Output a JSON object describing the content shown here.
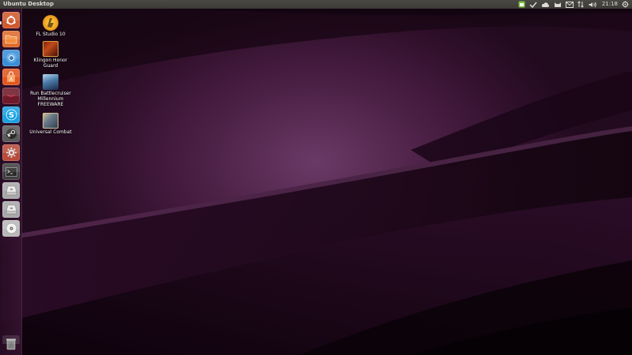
{
  "panel": {
    "title": "Ubuntu Desktop",
    "clock": "21:18",
    "indicators": [
      {
        "icon": "indicator-app-icon"
      },
      {
        "icon": "indicator-checkmark-icon"
      },
      {
        "icon": "indicator-cloud-icon"
      },
      {
        "icon": "indicator-cat-icon"
      },
      {
        "icon": "indicator-messages-icon"
      },
      {
        "icon": "indicator-network-icon"
      },
      {
        "icon": "indicator-volume-icon"
      },
      {
        "icon": "indicator-power-icon"
      }
    ]
  },
  "launcher": {
    "items": [
      {
        "name": "dash-home",
        "icon": "ubuntu-logo-icon",
        "color": "#d05a2e"
      },
      {
        "name": "files",
        "icon": "files-folder-icon",
        "color": "#e06a2a"
      },
      {
        "name": "chromium",
        "icon": "chromium-icon",
        "color": "#3a8fd6"
      },
      {
        "name": "software-center",
        "icon": "shopping-bag-icon",
        "color": "#e2571f"
      },
      {
        "name": "app-dark-red",
        "icon": "app-red-icon",
        "color": "#6e1a2a"
      },
      {
        "name": "skype",
        "icon": "skype-icon",
        "color": "#1aa0e0"
      },
      {
        "name": "steam",
        "icon": "steam-icon",
        "color": "#6a6a6a"
      },
      {
        "name": "system-settings",
        "icon": "gear-icon",
        "color": "#b84a3a"
      },
      {
        "name": "terminal",
        "icon": "terminal-icon",
        "color": "#4a4a4a"
      },
      {
        "name": "disk-1",
        "icon": "drive-icon",
        "color": "#9a9a9a"
      },
      {
        "name": "disk-2",
        "icon": "drive-icon",
        "color": "#9a9a9a"
      },
      {
        "name": "dvd",
        "icon": "dvd-icon",
        "color": "#b0b0b0"
      }
    ],
    "trash": {
      "icon": "trash-icon"
    }
  },
  "desktop": {
    "icons": [
      {
        "label": "FL Studio 10",
        "icon": "fl-studio-icon"
      },
      {
        "label": "Klingon Honor\nGuard",
        "icon": "klingon-honor-guard-icon"
      },
      {
        "label": "Run Battlecruiser\nMillennium\nFREEWARE",
        "icon": "battlecruiser-icon"
      },
      {
        "label": "Universal Combat",
        "icon": "universal-combat-icon"
      }
    ]
  }
}
